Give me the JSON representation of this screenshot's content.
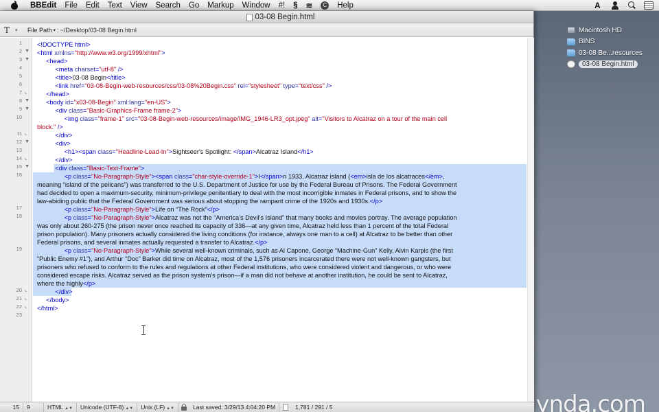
{
  "menubar": {
    "app": "BBEdit",
    "items": [
      "File",
      "Edit",
      "Text",
      "View",
      "Search",
      "Go",
      "Markup",
      "Window",
      "#!"
    ],
    "help": "Help",
    "extra_glyph": "C"
  },
  "window": {
    "title": "03-08 Begin.html",
    "toolbar": {
      "file_path_label": "File Path",
      "file_path_sep": ":",
      "file_path_value": "~/Desktop/03-08 Begin.html"
    }
  },
  "editor": {
    "line_numbers": [
      "1",
      "2",
      "3",
      "4",
      "5",
      "6",
      "7",
      "8",
      "9",
      "10",
      "",
      "11",
      "12",
      "13",
      "14",
      "15",
      "16",
      "",
      "",
      "17",
      "18",
      "",
      "",
      "19",
      "",
      "",
      "",
      "20",
      "21",
      "22",
      "23"
    ],
    "cursor": {
      "line": 15,
      "column": 9
    }
  },
  "status": {
    "line": "15",
    "column": "9",
    "language": "HTML",
    "encoding": "Unicode (UTF-8)",
    "line_endings": "Unix (LF)",
    "last_saved": "Last saved: 3/29/13 4:04:20 PM",
    "counts": "1,781 / 291 / 5"
  },
  "desktop": {
    "items": [
      {
        "label": "Macintosh HD",
        "icon": "hard-drive-icon",
        "selected": false
      },
      {
        "label": "BINS",
        "icon": "folder-icon",
        "selected": false
      },
      {
        "label": "03-08 Be...resources",
        "icon": "folder-icon",
        "selected": false
      },
      {
        "label": "03-08 Begin.html",
        "icon": "html-file-icon",
        "selected": true
      }
    ],
    "watermark": "lynda.com"
  },
  "colors": {
    "selection": "#c6dcf8",
    "tag": "#0000c8",
    "attribute_name": "#2e34a0",
    "attribute_value": "#b2001c"
  },
  "code": {
    "l1": "<!DOCTYPE html>",
    "l2a": "<html",
    "l2b": "xmlns",
    "l2c": "=",
    "l2d": "\"http://www.w3.org/1999/xhtml\"",
    "l2e": ">",
    "l3": "<head>",
    "l4a": "<meta",
    "l4b": "charset",
    "l4c": "=",
    "l4d": "\"utf-8\"",
    "l4e": " />",
    "l5a": "<title>",
    "l5b": "03-08 Begin",
    "l5c": "</title>",
    "l6a": "<link",
    "l6b": "href",
    "l6c": "=",
    "l6d": "\"03-08-Begin-web-resources/css/03-08%20Begin.css\"",
    "l6e": "rel",
    "l6f": "=",
    "l6g": "\"stylesheet\"",
    "l6h": "type",
    "l6i": "=",
    "l6j": "\"text/css\"",
    "l6k": " />",
    "l7": "</head>",
    "l8a": "<body",
    "l8b": "id",
    "l8c": "=",
    "l8d": "\"x03-08-Begin\"",
    "l8e": "xml:lang",
    "l8f": "=",
    "l8g": "\"en-US\"",
    "l8h": ">",
    "l9a": "<div",
    "l9b": "class",
    "l9c": "=",
    "l9d": "\"Basic-Graphics-Frame frame-2\"",
    "l9e": ">",
    "l10a": "<img",
    "l10b": "class",
    "l10c": "=",
    "l10d": "\"frame-1\"",
    "l10e": "src",
    "l10f": "=",
    "l10g": "\"03-08-Begin-web-resources/image/IMG_1946-LR3_opt.jpeg\"",
    "l10h": "alt",
    "l10i": "=",
    "l10j": "\"Visitors to Alcatraz on a tour of the main cell",
    "l10k": "block.\"",
    "l10l": " />",
    "l11": "</div>",
    "l12": "<div>",
    "l13a": "<h1>",
    "l13b": "<span",
    "l13c": "class",
    "l13d": "=",
    "l13e": "\"Headline-Lead-In\"",
    "l13f": ">",
    "l13g": "Sightseer's Spotlight: ",
    "l13h": "</span>",
    "l13i": "Alcatraz Island",
    "l13j": "</h1>",
    "l14": "</div>",
    "l15a": "<div",
    "l15b": "class",
    "l15c": "=",
    "l15d": "\"Basic-Text-Frame\"",
    "l15e": ">",
    "l16a": "<p",
    "l16b": "class",
    "l16c": "=",
    "l16d": "\"No-Paragraph-Style\"",
    "l16e": ">",
    "l16f": "<span",
    "l16g": "class",
    "l16h": "=",
    "l16i": "\"char-style-override-1\"",
    "l16j": ">",
    "l16k": "I",
    "l16l": "</span>",
    "l16m": "n 1933, Alcatraz island (",
    "l16n": "<em>",
    "l16o": "isla de los alcatraces",
    "l16p": "</em>",
    "l16q": ",",
    "l16w2": "meaning “island of the pelicans”) was transferred to the U.S. Department of Justice for use by the Federal Bureau of Prisons. The Federal Government",
    "l16w3a": "law-abiding public that the Federal Government was serious about stopping the rampant crime of the 1920s and 1930s.",
    "l16w3b": "</p>",
    "l16w2b": "had decided to open a maximum-security, minimum-privilege penitentiary to deal with the most incorrigible inmates in Federal prisons, and to show the",
    "l17a": "<p",
    "l17b": "class",
    "l17c": "=",
    "l17d": "\"No-Paragraph-Style\"",
    "l17e": ">",
    "l17f": "Life on “The Rock”",
    "l17g": "</p>",
    "l18a": "<p",
    "l18b": "class",
    "l18c": "=",
    "l18d": "\"No-Paragraph-Style\"",
    "l18e": ">",
    "l18f": "Alcatraz was not the “America’s Devil’s Island” that many books and movies portray. The average population",
    "l18w2": "was only about 260-275 (the prison never once reached its capacity of 336—at any given time, Alcatraz held less than 1 percent of the total Federal",
    "l18w3": "prison population). Many prisoners actually considered the living conditions (for instance, always one man to a cell) at Alcatraz to be better than other",
    "l18w4a": "Federal prisons, and several inmates actually requested a transfer to Alcatraz.",
    "l18w4b": "</p>",
    "l19a": "<p",
    "l19b": "class",
    "l19c": "=",
    "l19d": "\"No-Paragraph-Style\"",
    "l19e": ">",
    "l19f": "While several well-known criminals, such as Al Capone, George “Machine-Gun” Kelly, Alvin Karpis (the first",
    "l19w2": "“Public Enemy #1”), and Arthur “Doc” Barker did time on Alcatraz, most of the 1,576 prisoners incarcerated there were not well-known gangsters, but",
    "l19w3": "prisoners who refused to conform to the rules and regulations at other Federal institutions, who were considered violent and dangerous, or who were",
    "l19w4": "considered escape risks. Alcatraz served as the prison system’s prison—if a man did not behave at another institution, he could be sent to Alcatraz,",
    "l19w5a": "where the highly",
    "l19w5b": "</p>",
    "l20": "</div>",
    "l21": "</body>",
    "l22": "</html>"
  }
}
